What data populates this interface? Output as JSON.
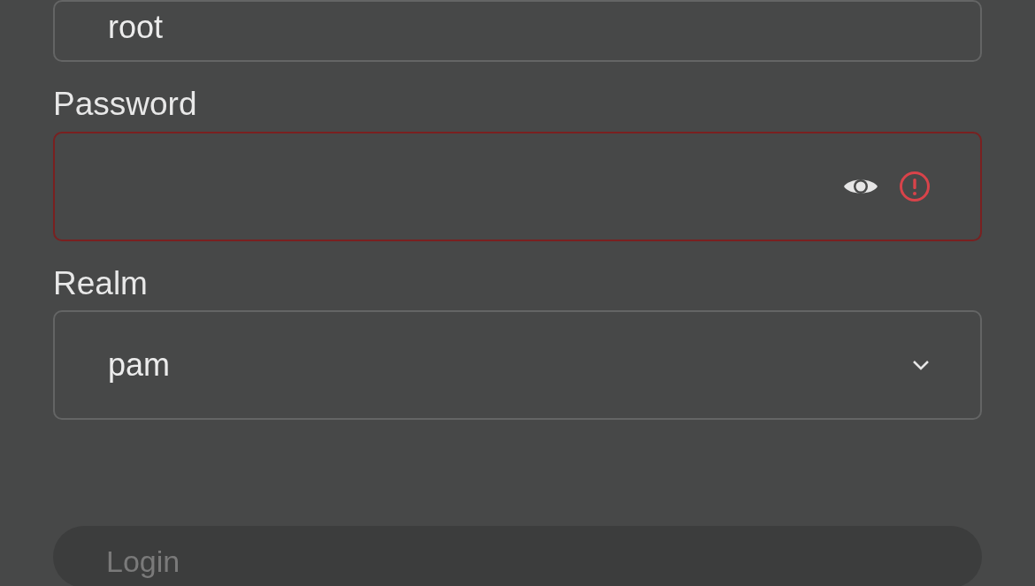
{
  "fields": [
    {
      "kind": "text",
      "value": "root",
      "invalid": false
    },
    {
      "kind": "password",
      "label": "Password",
      "invalid": true
    },
    {
      "kind": "select",
      "label": "Realm",
      "value": "pam",
      "invalid": false
    }
  ],
  "login_button": {
    "label": "Login",
    "disabled": true
  }
}
